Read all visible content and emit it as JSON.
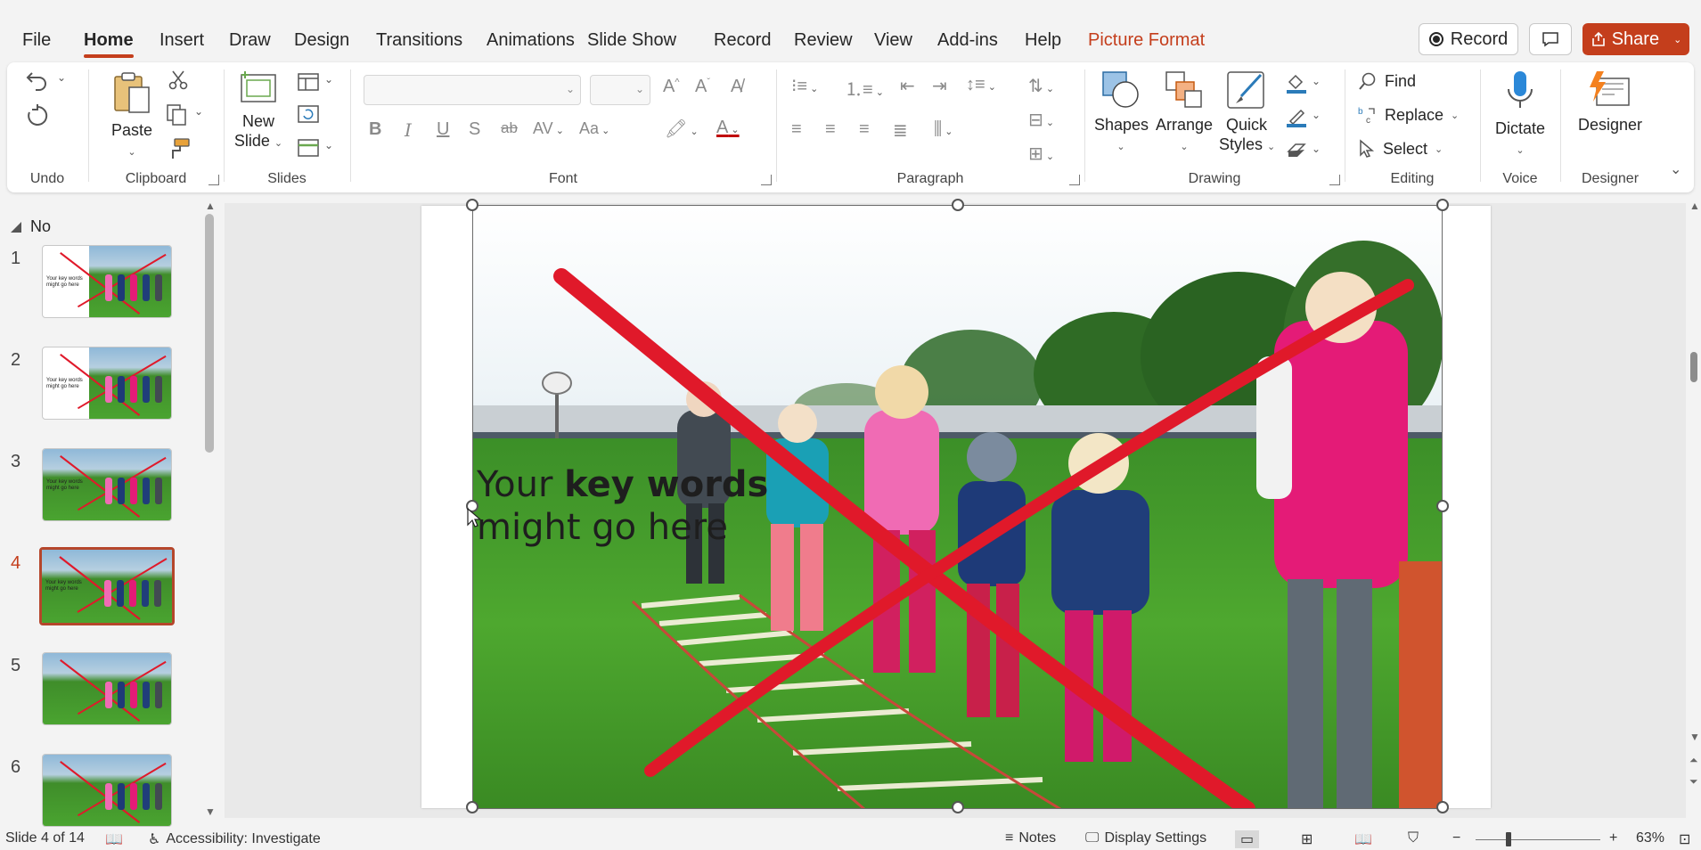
{
  "tabs": [
    "File",
    "Home",
    "Insert",
    "Draw",
    "Design",
    "Transitions",
    "Animations",
    "Slide Show",
    "Record",
    "Review",
    "View",
    "Add-ins",
    "Help",
    "Picture Format"
  ],
  "active_tab": "Home",
  "topbar": {
    "record_label": "Record",
    "share_label": "Share"
  },
  "ribbon": {
    "groups": {
      "undo": "Undo",
      "clipboard": "Clipboard",
      "slides": "Slides",
      "font": "Font",
      "paragraph": "Paragraph",
      "drawing": "Drawing",
      "editing": "Editing",
      "voice": "Voice",
      "designer": "Designer"
    },
    "paste_label": "Paste",
    "new_slide_label_1": "New",
    "new_slide_label_2": "Slide",
    "shapes_label": "Shapes",
    "arrange_label": "Arrange",
    "quick_styles_1": "Quick",
    "quick_styles_2": "Styles",
    "find_label": "Find",
    "replace_label": "Replace",
    "select_label": "Select",
    "dictate_label": "Dictate",
    "designer_label": "Designer"
  },
  "thumbnails": {
    "section_name": "No",
    "slides": [
      {
        "num": "1",
        "text_1": "Your key words",
        "text_2": "might go here"
      },
      {
        "num": "2",
        "text_1": "Your key words",
        "text_2": "might go here"
      },
      {
        "num": "3",
        "text_1": "Your key words",
        "text_2": "might go here"
      },
      {
        "num": "4",
        "text_1": "Your key words",
        "text_2": "might go here"
      },
      {
        "num": "5",
        "text_1": "",
        "text_2": ""
      },
      {
        "num": "6",
        "text_1": "",
        "text_2": ""
      }
    ],
    "active_index": 3
  },
  "slide": {
    "text_plain": "Your ",
    "text_bold": "key words",
    "text_line2": "might go here"
  },
  "status": {
    "slide_indicator": "Slide 4 of 14",
    "accessibility": "Accessibility: Investigate",
    "notes": "Notes",
    "display_settings": "Display Settings",
    "zoom_minus": "−",
    "zoom_plus": "+",
    "zoom": "63%"
  },
  "colors": {
    "accent": "#c43e1c",
    "red_x": "#e0192a"
  }
}
